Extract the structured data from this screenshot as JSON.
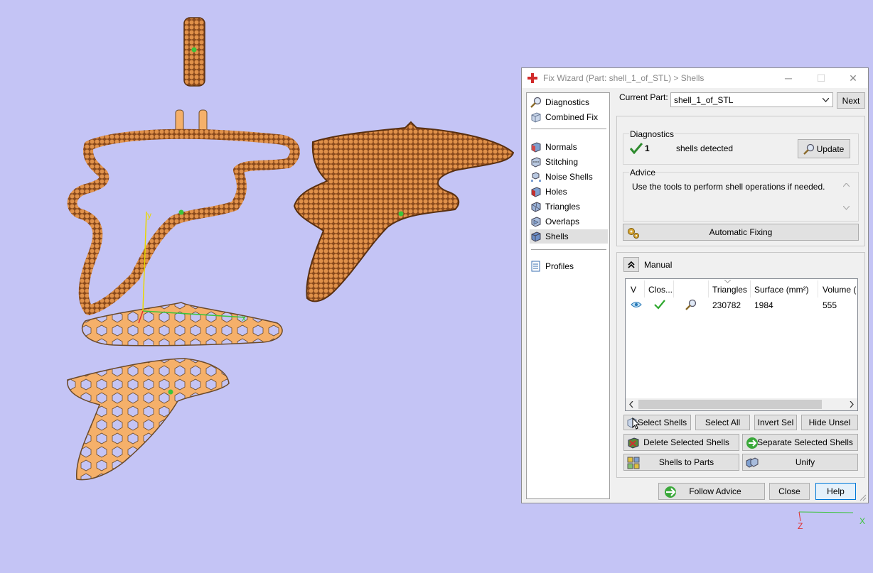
{
  "colors": {
    "background": "#c4c4f5",
    "part_orange": "#f5b06a",
    "dot_brown": "#a0521c",
    "check_green": "#2e8b2e",
    "help_blue": "#0078d7"
  },
  "viewport": {
    "axis_y": "y",
    "axis_x": "x",
    "axis_z": "Z",
    "axis_x2": "X"
  },
  "dialog": {
    "title": "Fix Wizard (Part: shell_1_of_STL) > Shells",
    "window_buttons": {
      "minimize": "─",
      "maximize": "☐",
      "close": "✕"
    },
    "nav": {
      "top": [
        {
          "label": "Diagnostics",
          "icon": "magnifier-icon"
        },
        {
          "label": "Combined Fix",
          "icon": "cube-icon"
        }
      ],
      "items": [
        {
          "label": "Normals",
          "icon": "normals-cube-icon"
        },
        {
          "label": "Stitching",
          "icon": "stitching-cube-icon"
        },
        {
          "label": "Noise Shells",
          "icon": "noise-cube-icon"
        },
        {
          "label": "Holes",
          "icon": "holes-cube-icon"
        },
        {
          "label": "Triangles",
          "icon": "triangles-cube-icon"
        },
        {
          "label": "Overlaps",
          "icon": "overlaps-cube-icon"
        },
        {
          "label": "Shells",
          "icon": "shells-cube-icon"
        }
      ],
      "bottom": [
        {
          "label": "Profiles",
          "icon": "document-icon"
        }
      ]
    },
    "current_part_label": "Current Part:",
    "current_part_value": "shell_1_of_STL",
    "next_button": "Next",
    "diagnostics": {
      "heading": "Diagnostics",
      "count": "1",
      "message": "shells detected",
      "update_button": "Update"
    },
    "advice": {
      "heading": "Advice",
      "text": "Use the tools to perform shell operations if needed."
    },
    "automatic_fixing_button": "Automatic Fixing",
    "manual": {
      "label": "Manual",
      "collapse_icon": "double-chevron-up-icon"
    },
    "table": {
      "columns": [
        "V",
        "Clos...",
        "",
        "Triangles",
        "Surface (mm²)",
        "Volume ("
      ],
      "rows": [
        {
          "triangles": "230782",
          "surface": "1984",
          "volume": "555"
        }
      ]
    },
    "buttons": {
      "select_shells": "Select Shells",
      "select_all": "Select All",
      "invert_sel": "Invert Sel",
      "hide_unsel": "Hide Unsel",
      "delete_selected_shells": "Delete Selected Shells",
      "separate_selected_shells": "Separate Selected Shells",
      "shells_to_parts": "Shells to Parts",
      "unify": "Unify",
      "follow_advice": "Follow Advice",
      "close": "Close",
      "help": "Help"
    }
  }
}
